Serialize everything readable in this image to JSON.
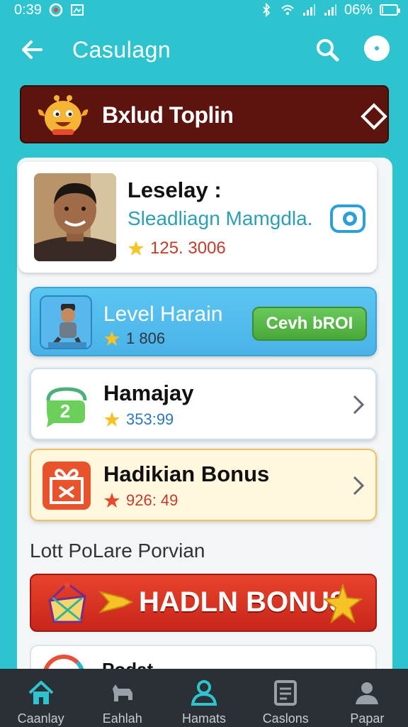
{
  "status_bar": {
    "time": "0:39",
    "battery": "06%",
    "icons": [
      "notification-icon",
      "image-icon",
      "bluetooth-icon",
      "wifi-icon",
      "signal-icon",
      "signal-icon",
      "battery-icon"
    ]
  },
  "appbar": {
    "title": "Casulagn"
  },
  "banner": {
    "title": "Bxlud Toplin"
  },
  "profile_card": {
    "name": "Leselay :",
    "subtitle": "Sleadliagn Mamgdla.",
    "points": "125. 3006"
  },
  "level_card": {
    "title": "Level Harain",
    "value": "1  806",
    "button_label": "Cevh bROI"
  },
  "rows": [
    {
      "title": "Hamajay",
      "value": "353:99"
    },
    {
      "title": "Hadikian Bonus",
      "value": "926: 49"
    }
  ],
  "section_label": "Lott PoLare Porvian",
  "big_banner": {
    "text": "HADLN BONUS"
  },
  "peek_card": {
    "text": "Podat"
  },
  "nav": [
    {
      "label": "Caanlay"
    },
    {
      "label": "Eahlah"
    },
    {
      "label": "Hamats"
    },
    {
      "label": "Caslons"
    },
    {
      "label": "Papar"
    }
  ],
  "colors": {
    "background": "#2ec4cf",
    "banner": "#5e140e",
    "accent_red": "#c8261a",
    "claim_green": "#48a838",
    "level_blue": "#49b3e8",
    "navbar": "#2b2f36",
    "nav_active": "#2ec4cf"
  }
}
